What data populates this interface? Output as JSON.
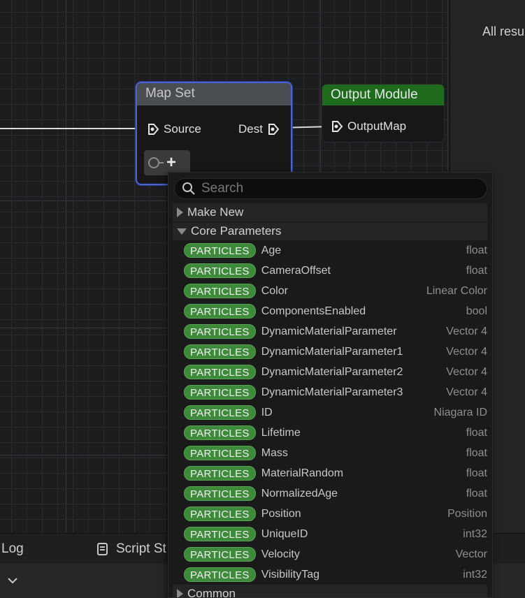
{
  "right_panel": {
    "message": "All resu"
  },
  "map_set_node": {
    "title": "Map Set",
    "source_pin": "Source",
    "dest_pin": "Dest"
  },
  "output_node": {
    "title": "Output Module",
    "pin": "OutputMap"
  },
  "search": {
    "placeholder": "Search",
    "value": ""
  },
  "categories": {
    "make_new": "Make New",
    "core_parameters": "Core Parameters",
    "common": "Common"
  },
  "parameters": [
    {
      "namespace": "PARTICLES",
      "name": "Age",
      "type": "float"
    },
    {
      "namespace": "PARTICLES",
      "name": "CameraOffset",
      "type": "float"
    },
    {
      "namespace": "PARTICLES",
      "name": "Color",
      "type": "Linear Color"
    },
    {
      "namespace": "PARTICLES",
      "name": "ComponentsEnabled",
      "type": "bool"
    },
    {
      "namespace": "PARTICLES",
      "name": "DynamicMaterialParameter",
      "type": "Vector 4"
    },
    {
      "namespace": "PARTICLES",
      "name": "DynamicMaterialParameter1",
      "type": "Vector 4"
    },
    {
      "namespace": "PARTICLES",
      "name": "DynamicMaterialParameter2",
      "type": "Vector 4"
    },
    {
      "namespace": "PARTICLES",
      "name": "DynamicMaterialParameter3",
      "type": "Vector 4"
    },
    {
      "namespace": "PARTICLES",
      "name": "ID",
      "type": "Niagara ID"
    },
    {
      "namespace": "PARTICLES",
      "name": "Lifetime",
      "type": "float"
    },
    {
      "namespace": "PARTICLES",
      "name": "Mass",
      "type": "float"
    },
    {
      "namespace": "PARTICLES",
      "name": "MaterialRandom",
      "type": "float"
    },
    {
      "namespace": "PARTICLES",
      "name": "NormalizedAge",
      "type": "float"
    },
    {
      "namespace": "PARTICLES",
      "name": "Position",
      "type": "Position"
    },
    {
      "namespace": "PARTICLES",
      "name": "UniqueID",
      "type": "int32"
    },
    {
      "namespace": "PARTICLES",
      "name": "Velocity",
      "type": "Vector"
    },
    {
      "namespace": "PARTICLES",
      "name": "VisibilityTag",
      "type": "int32"
    }
  ],
  "bottom_tabs": {
    "log": "Log",
    "script_stats": "Script St"
  },
  "colors": {
    "node_selected_border": "#4a63d6",
    "namespace_badge": "#3d8a3a",
    "output_header": "#1f6b1e"
  }
}
